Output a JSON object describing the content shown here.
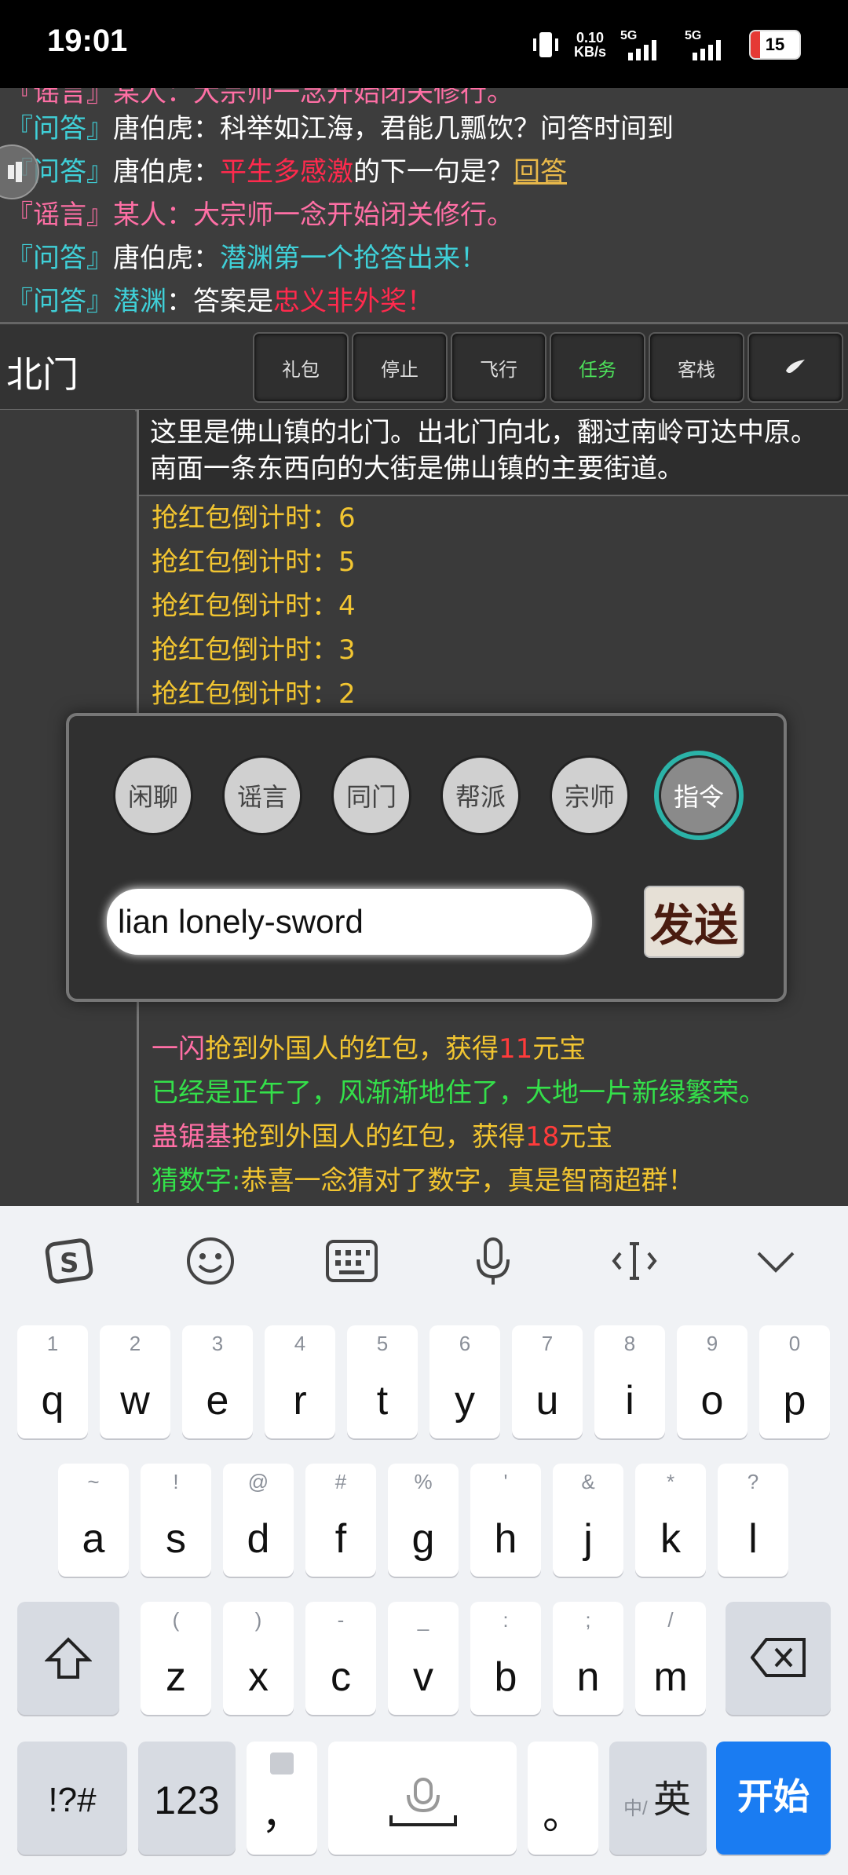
{
  "status_bar": {
    "time": "19:01",
    "net_speed": "0.10",
    "net_unit": "KB/s",
    "sim1": "5G",
    "sim2": "5G",
    "battery": "15"
  },
  "chat_log": {
    "partial_top": "『谣言』某人：大宗师一念开始闭关修行。",
    "line1_tag": "『问答』",
    "line1_name": "唐伯虎：",
    "line1_text": "科举如江海，君能几瓢饮？问答时间到",
    "line2_tag": "『问答』",
    "line2_name": "唐伯虎：",
    "line2_quote": "平生多感激",
    "line2_text": "的下一句是？",
    "line2_link": "回答",
    "line3_tag": "『谣言』",
    "line3_text": "某人：大宗师一念开始闭关修行。",
    "line4_tag": "『问答』",
    "line4_name": "唐伯虎：",
    "line4_text": "潜渊第一个抢答出来！",
    "line5_tag": "『问答』",
    "line5_name": "潜渊",
    "line5_sep": "：答案是",
    "line5_answer": "忠义非外奖！"
  },
  "toolbar": {
    "room_name": "北门",
    "gift": "礼包",
    "stop": "停止",
    "fly": "飞行",
    "task": "任务",
    "inn": "客栈"
  },
  "room": {
    "description": "这里是佛山镇的北门。出北门向北，翻过南岭可达中原。南面一条东西向的大街是佛山镇的主要街道。",
    "countdown": [
      "抢红包倒计时：6",
      "抢红包倒计时：5",
      "抢红包倒计时：4",
      "抢红包倒计时：3",
      "抢红包倒计时：2"
    ],
    "msg1_name": "一闪",
    "msg1_mid": "抢到外国人的红包，获得",
    "msg1_amount": "11",
    "msg1_unit": "元宝",
    "msg2": "已经是正午了，风渐渐地住了，大地一片新绿繁荣。",
    "msg3_name": "蛊锯基",
    "msg3_mid": "抢到外国人的红包，获得",
    "msg3_amount": "18",
    "msg3_unit": "元宝",
    "msg4_label": "猜数字:",
    "msg4_text": "恭喜一念猜对了数字，真是智商超群！"
  },
  "dialog": {
    "channels": [
      "闲聊",
      "谣言",
      "同门",
      "帮派",
      "宗师",
      "指令"
    ],
    "active_channel": "指令",
    "input_value": "lian lonely-sword",
    "send_label": "发送"
  },
  "keyboard": {
    "row1": [
      [
        "1",
        "q"
      ],
      [
        "2",
        "w"
      ],
      [
        "3",
        "e"
      ],
      [
        "4",
        "r"
      ],
      [
        "5",
        "t"
      ],
      [
        "6",
        "y"
      ],
      [
        "7",
        "u"
      ],
      [
        "8",
        "i"
      ],
      [
        "9",
        "o"
      ],
      [
        "0",
        "p"
      ]
    ],
    "row2": [
      [
        "~",
        "a"
      ],
      [
        "!",
        "s"
      ],
      [
        "@",
        "d"
      ],
      [
        "#",
        "f"
      ],
      [
        "%",
        "g"
      ],
      [
        "'",
        "h"
      ],
      [
        "&",
        "j"
      ],
      [
        "*",
        "k"
      ],
      [
        "?",
        "l"
      ]
    ],
    "row3": [
      [
        "(",
        "z"
      ],
      [
        ")",
        "x"
      ],
      [
        "-",
        "c"
      ],
      [
        "_",
        "v"
      ],
      [
        ":",
        "b"
      ],
      [
        ";",
        "n"
      ],
      [
        "/",
        "m"
      ]
    ],
    "symbols": "!?#",
    "numbers": "123",
    "comma": "，",
    "period": "。",
    "lang_small": "中/",
    "lang_big": "英",
    "go": "开始"
  }
}
